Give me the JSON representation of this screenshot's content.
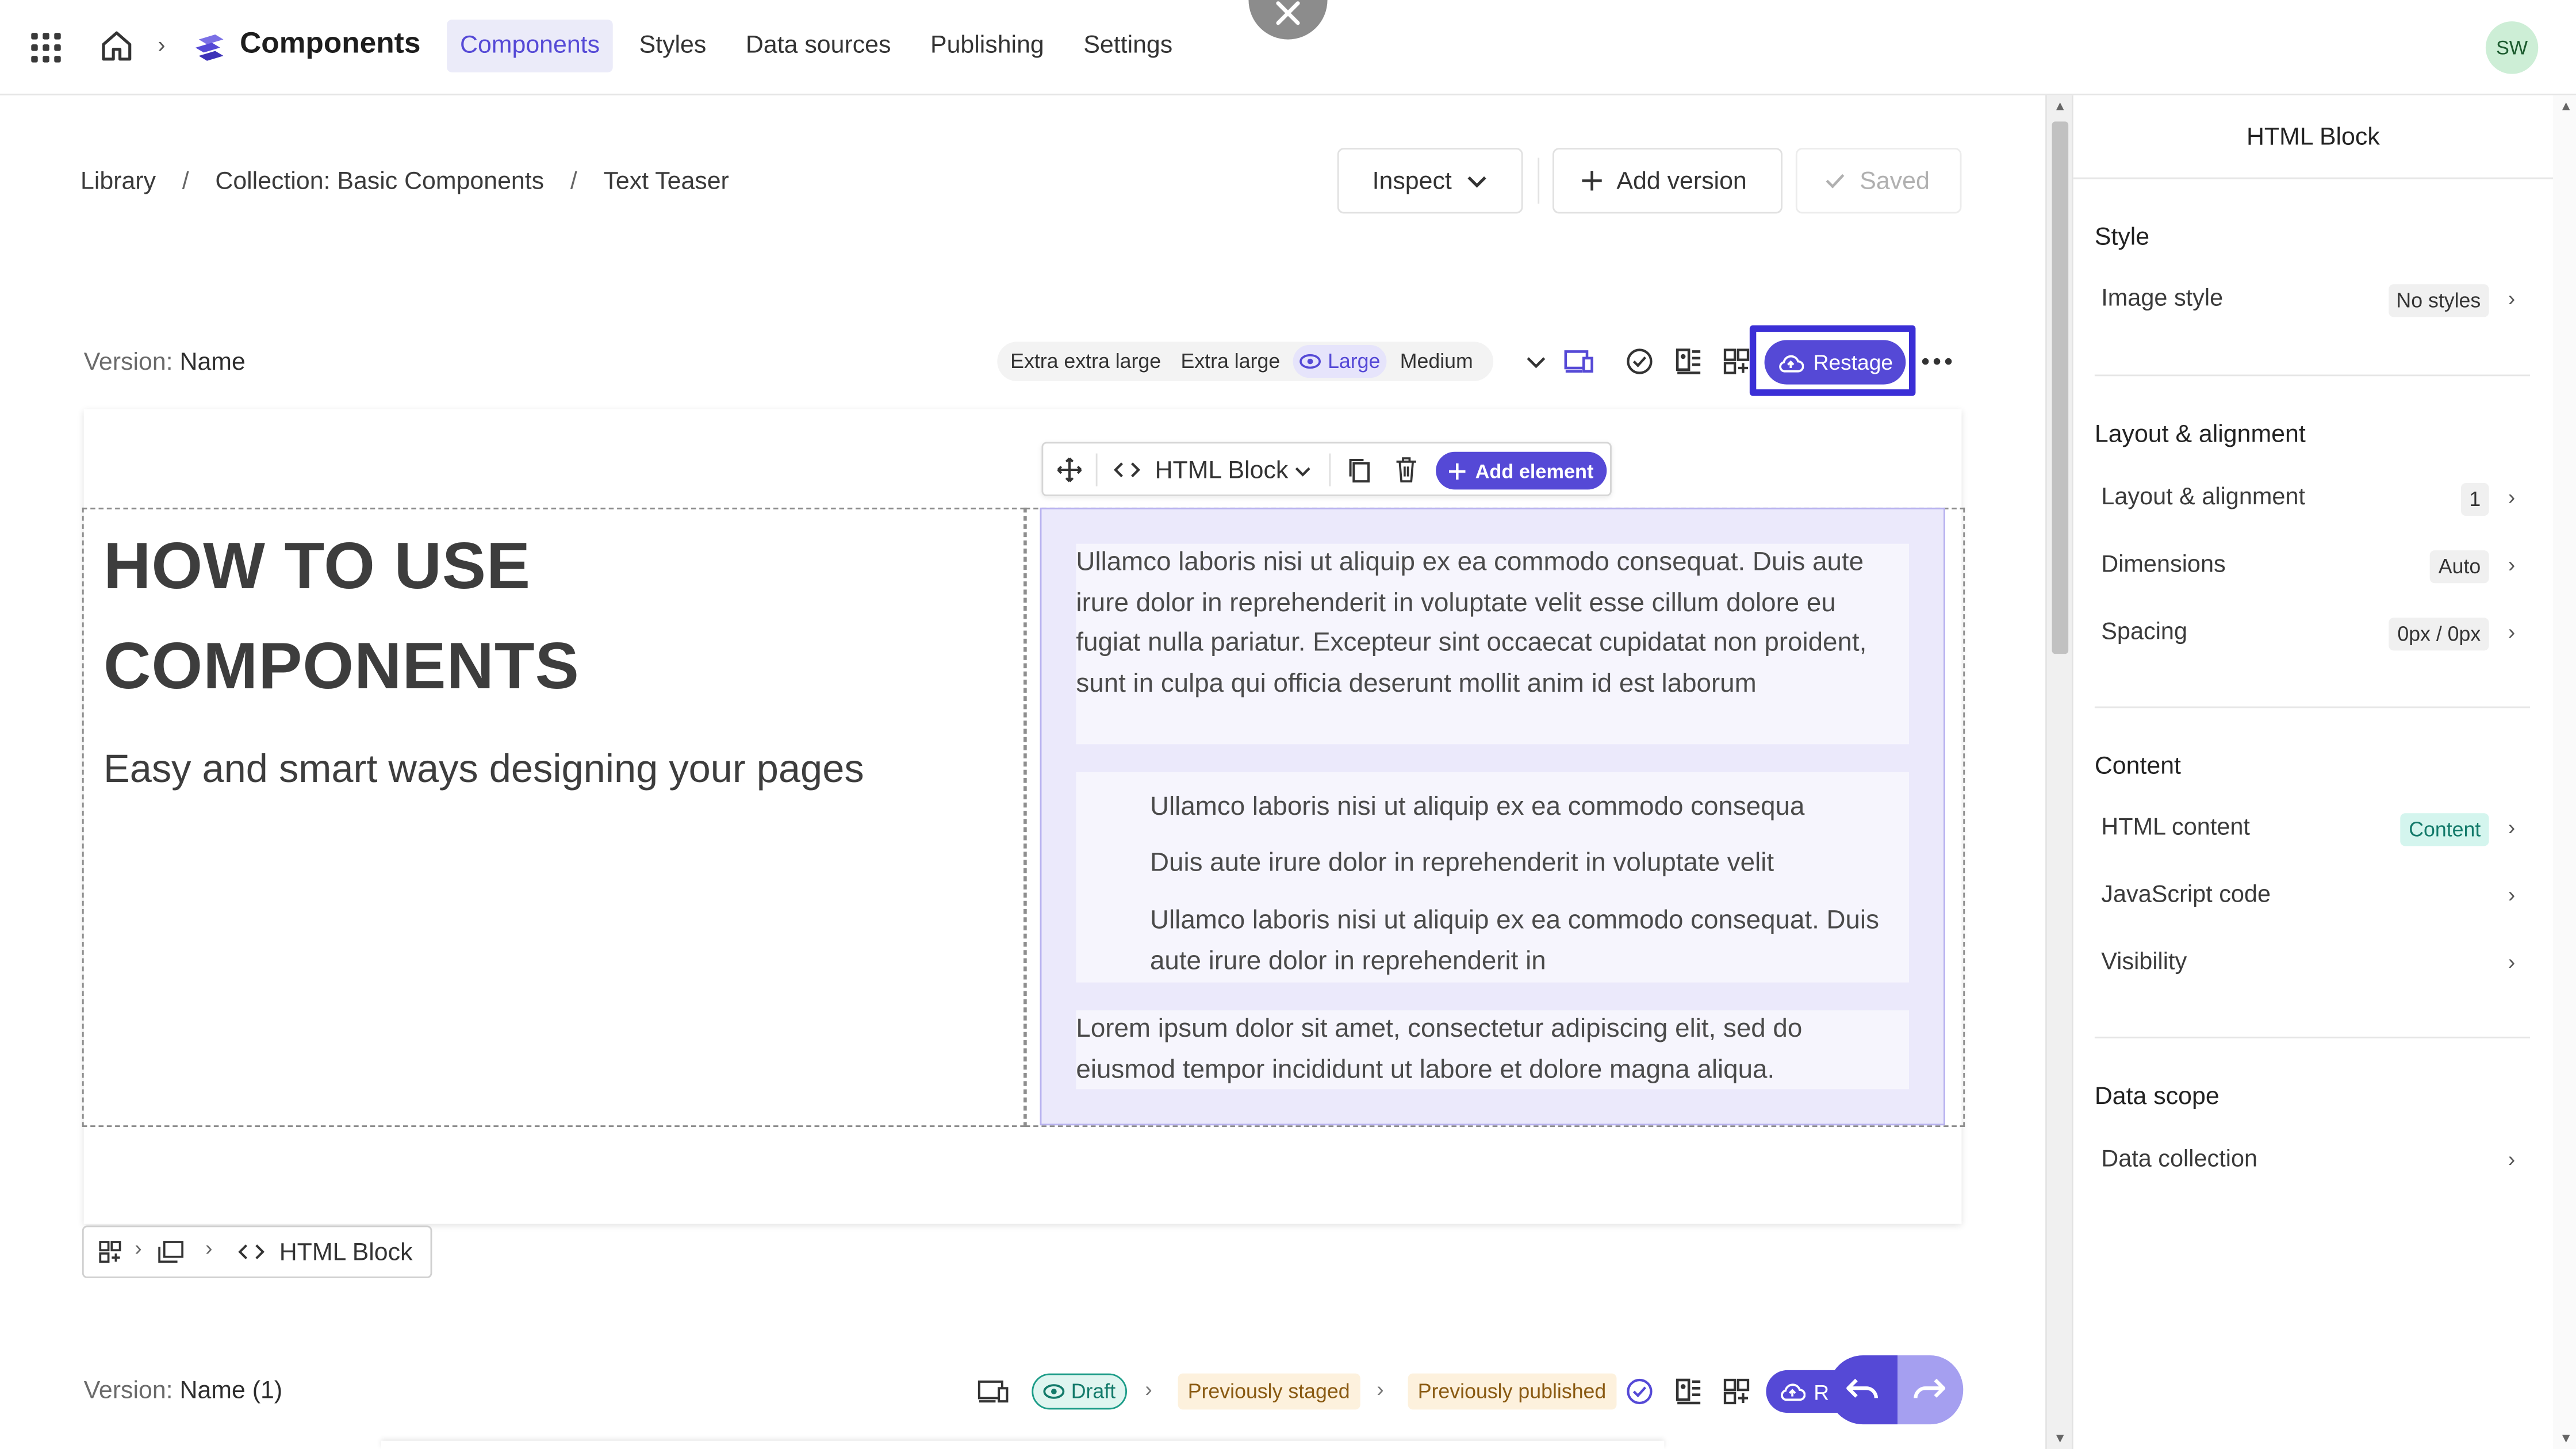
{
  "topbar": {
    "app_title": "Components",
    "tabs": [
      {
        "label": "Components",
        "active": true
      },
      {
        "label": "Styles",
        "active": false
      },
      {
        "label": "Data sources",
        "active": false
      },
      {
        "label": "Publishing",
        "active": false
      },
      {
        "label": "Settings",
        "active": false
      }
    ],
    "avatar_initials": "SW",
    "icons": [
      "apps-grid-icon",
      "home-icon",
      "chevron-right-icon",
      "brand-logo-icon",
      "close-icon"
    ]
  },
  "breadcrumb": {
    "items": [
      "Library",
      "Collection:  Basic Components",
      "Text Teaser"
    ],
    "separator": "/"
  },
  "actions": {
    "inspect_label": "Inspect",
    "add_version_label": "Add version",
    "saved_label": "Saved"
  },
  "version_row": {
    "prefix": "Version:",
    "name": "Name",
    "breakpoints": [
      "Extra extra large",
      "Extra large",
      "Large",
      "Medium"
    ],
    "active_breakpoint": "Large",
    "restage_label": "Restage"
  },
  "element_toolbar": {
    "element_type": "HTML Block",
    "add_element_label": "Add element"
  },
  "canvas": {
    "heading_line1": "HOW TO USE",
    "heading_line2": "COMPONENTS",
    "subheading": "Easy and smart ways designing your pages",
    "paragraph1": "Ullamco laboris nisi ut aliquip ex ea commodo consequat. Duis aute irure dolor in reprehenderit in voluptate velit esse cillum dolore eu fugiat nulla pariatur. Excepteur sint occaecat cupidatat non proident, sunt in culpa qui officia deserunt mollit anim id est laborum",
    "list_items": [
      "Ullamco laboris nisi ut aliquip ex ea commodo consequa",
      "Duis aute irure dolor in reprehenderit in voluptate velit",
      "Ullamco laboris nisi ut aliquip ex ea commodo consequat. Duis aute irure dolor in reprehenderit in"
    ],
    "paragraph2": "Lorem ipsum dolor sit amet, consectetur adipiscing elit, sed do eiusmod tempor incididunt ut labore et dolore magna aliqua."
  },
  "element_breadcrumb": {
    "current": "HTML Block"
  },
  "version_row_2": {
    "prefix": "Version:",
    "name": "Name (1)",
    "status_draft": "Draft",
    "status_staged": "Previously staged",
    "status_published": "Previously published",
    "restage_partial": "R"
  },
  "panel": {
    "title": "HTML Block",
    "sections": [
      {
        "title": "Style",
        "rows": [
          {
            "label": "Image style",
            "badge": "No styles"
          }
        ]
      },
      {
        "title": "Layout & alignment",
        "rows": [
          {
            "label": "Layout & alignment",
            "badge": "1"
          },
          {
            "label": "Dimensions",
            "badge": "Auto"
          },
          {
            "label": "Spacing",
            "badge": "0px / 0px"
          }
        ]
      },
      {
        "title": "Content",
        "rows": [
          {
            "label": "HTML content",
            "badge": "Content"
          },
          {
            "label": "JavaScript code",
            "badge": ""
          },
          {
            "label": "Visibility",
            "badge": ""
          }
        ]
      },
      {
        "title": "Data scope",
        "rows": [
          {
            "label": "Data collection",
            "badge": ""
          }
        ]
      }
    ]
  },
  "colors": {
    "accent": "#5549d6",
    "focus_ring": "#3b2fd6",
    "selection_fill": "#ebe9fb",
    "draft_teal": "#1c9c88",
    "status_amber_bg": "#fdf1dd"
  }
}
